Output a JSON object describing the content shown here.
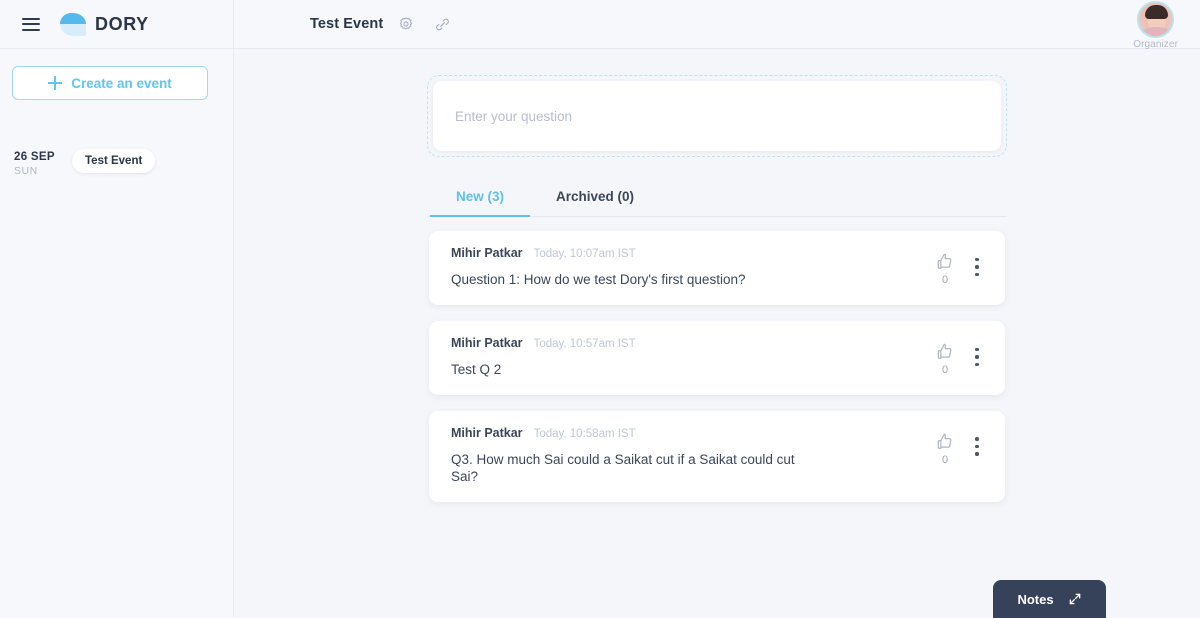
{
  "brand": {
    "name": "DORY",
    "logo_icon": "dory-fish-logo",
    "menu_icon": "hamburger-menu-icon"
  },
  "header": {
    "event_title": "Test Event",
    "settings_icon": "gear-icon",
    "link_icon": "link-icon",
    "profile": {
      "label": "Organizer",
      "avatar_icon": "user-avatar"
    }
  },
  "sidebar": {
    "create_button": {
      "label": "Create an event",
      "icon": "plus-icon"
    },
    "days": [
      {
        "date": "26 SEP",
        "weekday": "SUN",
        "events": [
          {
            "name": "Test Event"
          }
        ]
      }
    ]
  },
  "main": {
    "ask": {
      "placeholder": "Enter your question",
      "value": ""
    },
    "tabs": [
      {
        "label": "New (3)",
        "active": true
      },
      {
        "label": "Archived (0)",
        "active": false
      }
    ],
    "questions": [
      {
        "author": "Mihir Patkar",
        "time": "Today, 10:07am IST",
        "text": "Question 1: How do we test Dory's first question?",
        "likes": "0",
        "like_icon": "thumbs-up-icon",
        "menu_icon": "kebab-menu-icon"
      },
      {
        "author": "Mihir Patkar",
        "time": "Today, 10:57am IST",
        "text": "Test Q 2",
        "likes": "0",
        "like_icon": "thumbs-up-icon",
        "menu_icon": "kebab-menu-icon"
      },
      {
        "author": "Mihir Patkar",
        "time": "Today, 10:58am IST",
        "text": "Q3. How much Sai could a Saikat cut if a Saikat could cut Sai?",
        "likes": "0",
        "like_icon": "thumbs-up-icon",
        "menu_icon": "kebab-menu-icon"
      }
    ]
  },
  "notes": {
    "label": "Notes",
    "expand_icon": "expand-diagonal-icon"
  },
  "colors": {
    "accent": "#5ec0e8",
    "accent_light": "#9fd8f2",
    "text_dark": "#3b4659",
    "text_muted": "#c0c6d3",
    "background": "#f5f6fa",
    "panel": "#f7f8fc",
    "notes_bg": "#36415a"
  }
}
